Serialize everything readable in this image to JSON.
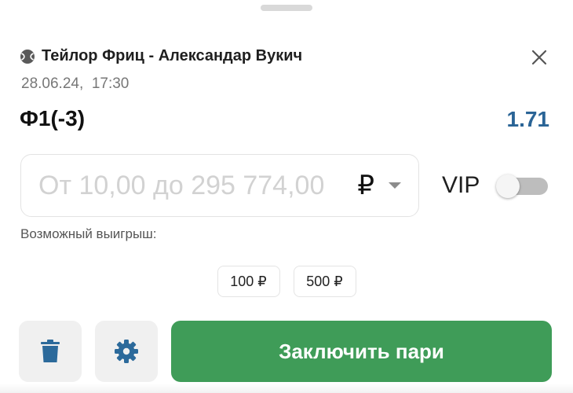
{
  "header": {
    "sport_icon": "tennis-ball-icon",
    "match_title": "Тейлор Фриц - Александар Вукич",
    "close_icon": "close-icon"
  },
  "event": {
    "date": "28.06.24,",
    "time": "17:30"
  },
  "bet": {
    "outcome": "Ф1(-3)",
    "odds": "1.71"
  },
  "stake": {
    "value": "",
    "placeholder": "От 10,00 до 295 774,00",
    "currency_symbol": "₽",
    "currency_dropdown_icon": "caret-down-icon"
  },
  "vip": {
    "label": "VIP",
    "enabled": false
  },
  "possible_win_label": "Возможный выигрыш:",
  "quick_amounts": [
    "100 ₽",
    "500 ₽"
  ],
  "actions": {
    "delete_icon": "trash-icon",
    "settings_icon": "gear-icon",
    "submit_label": "Заключить пари"
  },
  "colors": {
    "odds": "#2a6496",
    "submit_bg": "#3f9c58",
    "action_icons": "#2c6a9b"
  }
}
